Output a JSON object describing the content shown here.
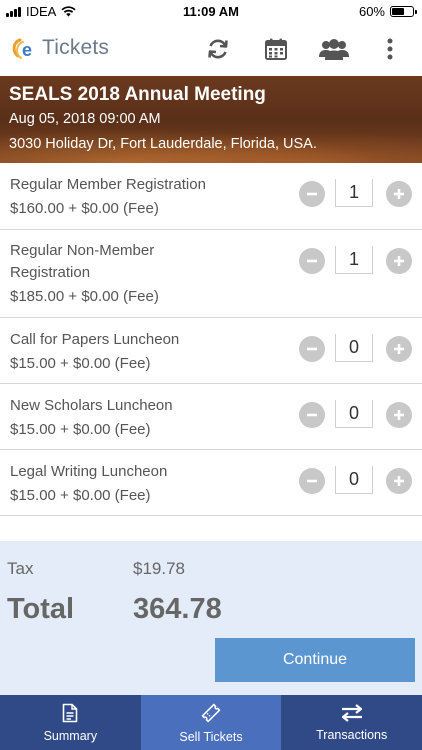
{
  "status_bar": {
    "carrier": "IDEA",
    "time": "11:09 AM",
    "battery": "60%",
    "battery_level": 0.6
  },
  "app": {
    "logo_text": "Tickets",
    "icons": [
      "refresh-icon",
      "calendar-icon",
      "group-icon",
      "more-vertical-icon"
    ]
  },
  "event": {
    "title": "SEALS 2018 Annual Meeting",
    "datetime": "Aug 05, 2018 09:00 AM",
    "address": "3030 Holiday Dr, Fort Lauderdale, Florida, USA."
  },
  "tickets": [
    {
      "name": "Regular Member Registration",
      "price": "$160.00 + $0.00 (Fee)",
      "quantity": "1"
    },
    {
      "name": "Regular Non-Member Registration",
      "price": "$185.00 + $0.00 (Fee)",
      "quantity": "1"
    },
    {
      "name": "Call for Papers Luncheon",
      "price": "$15.00 + $0.00 (Fee)",
      "quantity": "0"
    },
    {
      "name": "New Scholars Luncheon",
      "price": "$15.00 + $0.00 (Fee)",
      "quantity": "0"
    },
    {
      "name": "Legal Writing Luncheon",
      "price": "$15.00 + $0.00 (Fee)",
      "quantity": "0"
    }
  ],
  "totals": {
    "tax_label": "Tax",
    "tax_value": "$19.78",
    "total_label": "Total",
    "total_value": "364.78",
    "continue_label": "Continue"
  },
  "tabs": [
    {
      "label": "Summary",
      "icon": "document-icon",
      "active": false
    },
    {
      "label": "Sell Tickets",
      "icon": "ticket-icon",
      "active": true
    },
    {
      "label": "Transactions",
      "icon": "swap-arrows-icon",
      "active": false
    }
  ],
  "colors": {
    "tab_bar": "#2f4a86",
    "tab_active": "#4a6fbd",
    "continue_button": "#5b96d0",
    "totals_bg": "#e3ecf8",
    "banner": "#6b3a1f"
  }
}
